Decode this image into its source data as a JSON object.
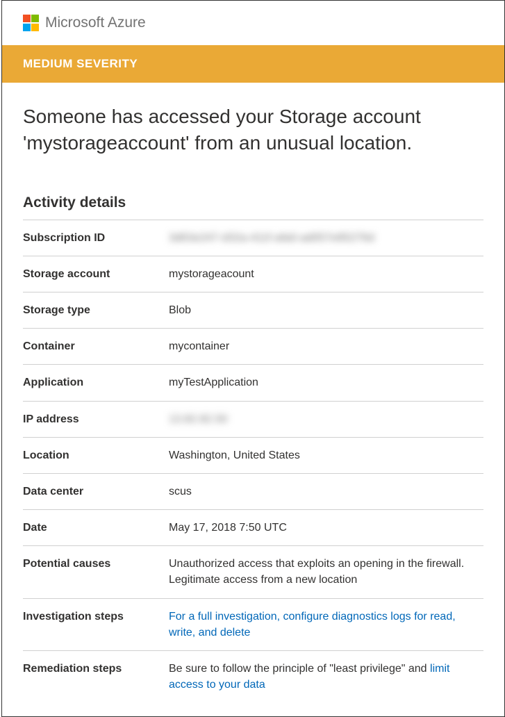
{
  "brand": {
    "name": "Microsoft Azure"
  },
  "severity": {
    "label": "MEDIUM SEVERITY"
  },
  "alert": {
    "title": "Someone has accessed your Storage account 'mystorageaccount' from an unusual location."
  },
  "section": {
    "activity_details": "Activity details"
  },
  "details": {
    "subscription_label": "Subscription ID",
    "subscription_value": "3d63e247-d32a-411f-afa0-ad057e85276d",
    "storage_account_label": "Storage account",
    "storage_account_value": "mystorageacount",
    "storage_type_label": "Storage type",
    "storage_type_value": "Blob",
    "container_label": "Container",
    "container_value": "mycontainer",
    "application_label": "Application",
    "application_value": "myTestApplication",
    "ip_label": "IP address",
    "ip_value": "13.82.82.50",
    "location_label": "Location",
    "location_value": "Washington, United States",
    "datacenter_label": "Data center",
    "datacenter_value": "scus",
    "date_label": "Date",
    "date_value": "May 17, 2018 7:50 UTC",
    "causes_label": "Potential causes",
    "causes_value": "Unauthorized access that exploits an opening in the firewall. Legitimate access from a new location",
    "investigation_label": "Investigation steps",
    "investigation_link": "For a full investigation, configure diagnostics logs for read, write, and delete",
    "remediation_label": "Remediation steps",
    "remediation_prefix": "Be sure to follow the principle of \"least privilege\" and ",
    "remediation_link": "limit access to your data"
  }
}
